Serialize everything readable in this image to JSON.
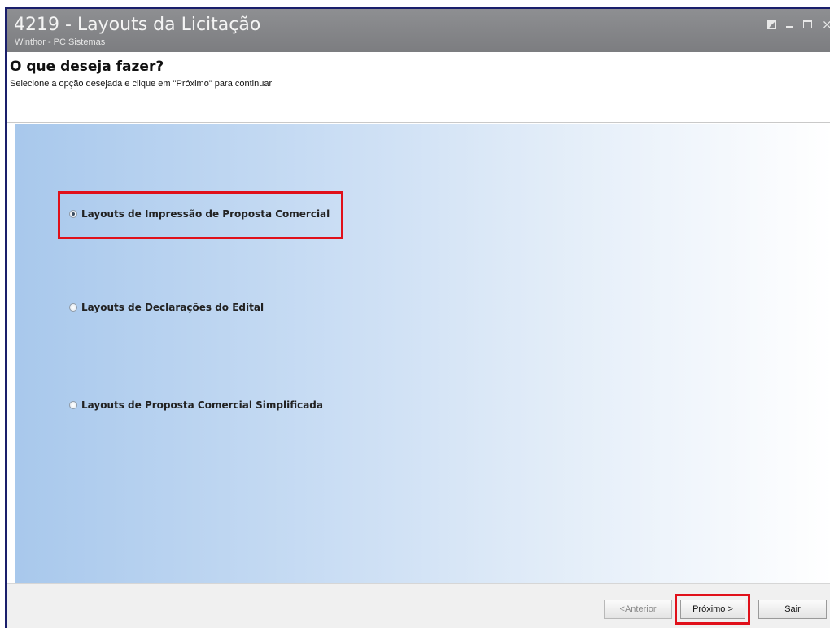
{
  "window": {
    "title": "4219 - Layouts da Licitação",
    "subtitle": "Winthor - PC Sistemas",
    "controls": [
      "restore-icon",
      "minimize-icon",
      "maximize-icon",
      "close-icon"
    ]
  },
  "header": {
    "title": "O que deseja fazer?",
    "subtitle": "Selecione a opção desejada e clique em \"Próximo\" para continuar"
  },
  "options": [
    {
      "label": "Layouts de Impressão de Proposta Comercial",
      "selected": true
    },
    {
      "label": "Layouts de Declarações do Edital",
      "selected": false
    },
    {
      "label": "Layouts de Proposta Comercial Simplificada",
      "selected": false
    }
  ],
  "footer": {
    "back": {
      "prefix": "< ",
      "accel": "A",
      "rest": "nterior",
      "enabled": false
    },
    "next": {
      "accel": "P",
      "rest": "róximo >",
      "enabled": true
    },
    "exit": {
      "accel": "S",
      "rest": "air",
      "enabled": true
    }
  },
  "colors": {
    "titlebar": "#858689",
    "highlight": "#e0101a",
    "window_border": "#1a1f6b"
  }
}
